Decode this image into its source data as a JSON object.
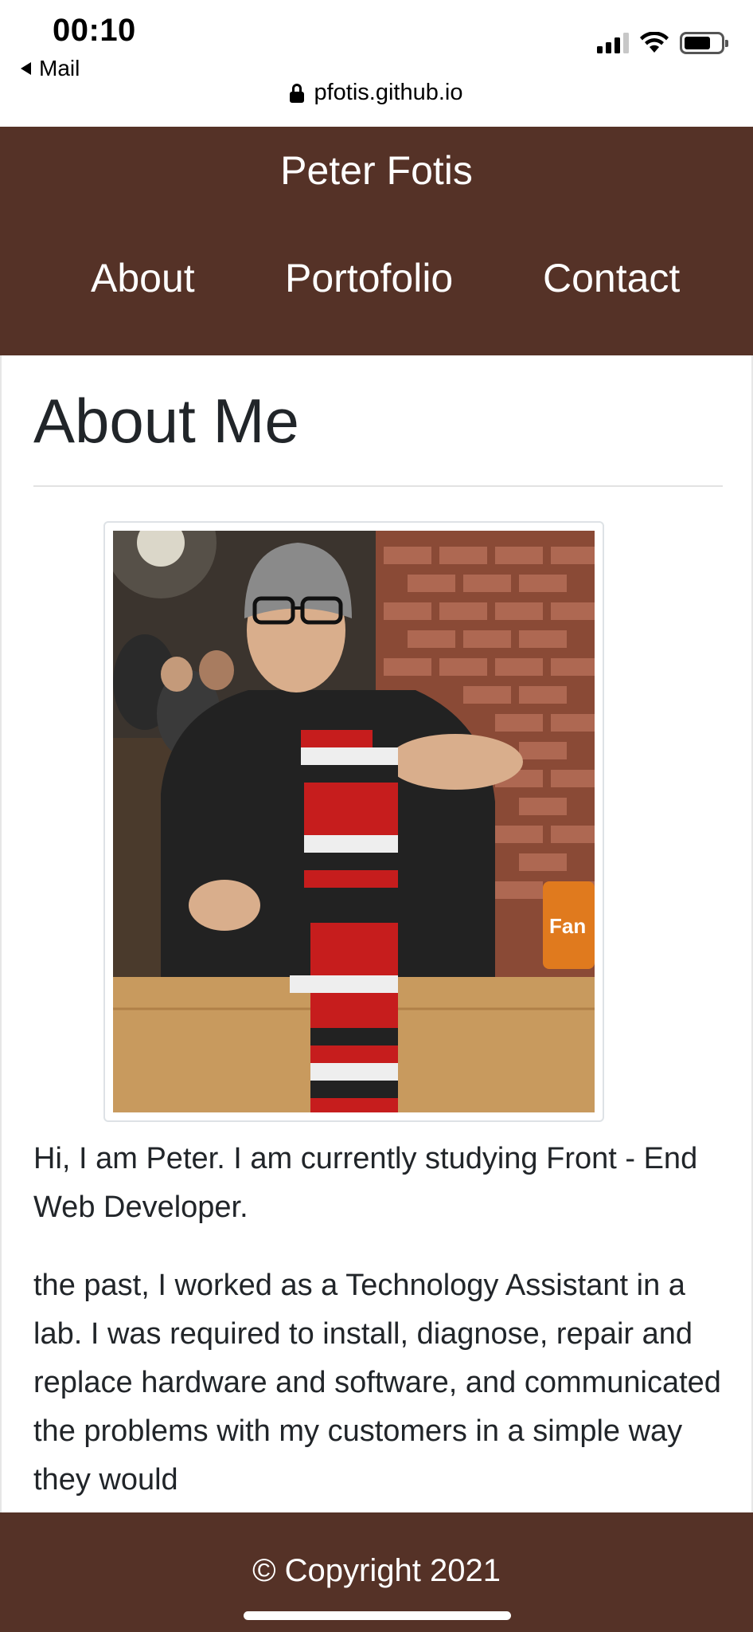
{
  "status_bar": {
    "time": "00:10",
    "back_label": "Mail",
    "url": "pfotis.github.io"
  },
  "header": {
    "site_title": "Peter Fotis",
    "nav": [
      "About",
      "Portofolio",
      "Contact"
    ]
  },
  "main": {
    "page_title": "About Me",
    "photo_alt": "Peter playing a stacking-blocks game at a table",
    "bio": [
      "Hi, I am Peter. I am currently studying Front - End Web Developer.",
      "the past, I worked as a Technology Assistant in a lab. I was required to install, diagnose, repair and replace hardware and software, and communicated the problems with my customers in a simple way they would"
    ]
  },
  "footer": {
    "copyright": "© Copyright 2021"
  },
  "colors": {
    "brand": "#553227",
    "text": "#212529",
    "white": "#ffffff"
  }
}
